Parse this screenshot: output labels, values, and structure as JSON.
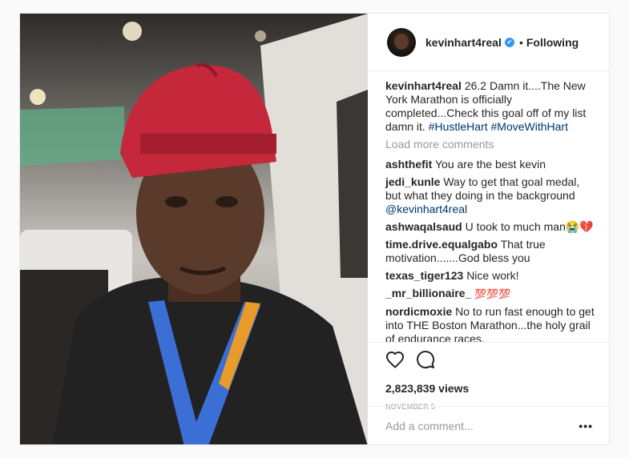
{
  "post": {
    "author": "kevinhart4real",
    "follow_status": "Following",
    "separator": "•",
    "caption": {
      "author": "kevinhart4real",
      "text": "26.2 Damn it....The New York Marathon is officially completed...Check this goal off of my list damn it.",
      "hashtags": "#HustleHart #MoveWithHart"
    },
    "load_more": "Load more comments",
    "comments": [
      {
        "user": "ashthefit",
        "text": "You are the best kevin"
      },
      {
        "user": "jedi_kunle",
        "text": "Way to get that goal medal, but what they doing in the background",
        "mention": "@kevinhart4real"
      },
      {
        "user": "ashwaqalsaud",
        "text": "U took to much man😭💔"
      },
      {
        "user": "time.drive.equalgabo",
        "text": "That true motivation.......God bless you"
      },
      {
        "user": "texas_tiger123",
        "text": "Nice work!"
      },
      {
        "user": "_mr_billionaire_",
        "text": "💯💯💯"
      },
      {
        "user": "nordicmoxie",
        "text": "No to run fast enough to get into THE Boston Marathon...the holy grail of endurance races."
      }
    ],
    "views": "2,823,839 views",
    "date": "NOVEMBER 5",
    "add_comment_placeholder": "Add a comment...",
    "more_glyph": "•••"
  },
  "icons": {
    "verified": "verified-badge-icon",
    "like": "heart-icon",
    "comment": "speech-bubble-icon"
  },
  "colors": {
    "link": "#003569",
    "verified": "#3897f0",
    "muted": "#999999",
    "cap": "#c4283a"
  }
}
